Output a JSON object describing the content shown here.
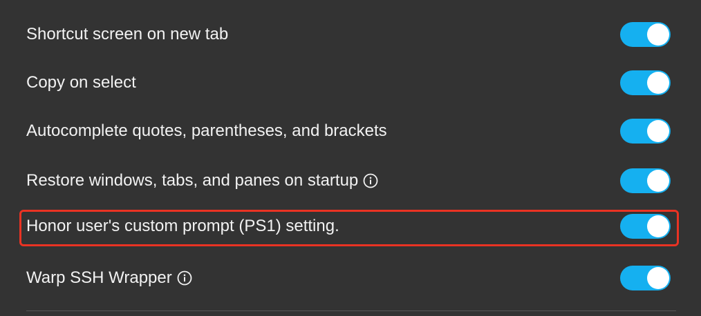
{
  "settings": [
    {
      "label": "Shortcut screen on new tab",
      "enabled": true,
      "has_info": false
    },
    {
      "label": "Copy on select",
      "enabled": true,
      "has_info": false
    },
    {
      "label": "Autocomplete quotes, parentheses, and brackets",
      "enabled": true,
      "has_info": false
    },
    {
      "label": "Restore windows, tabs, and panes on startup",
      "enabled": true,
      "has_info": true
    },
    {
      "label": "Honor user's custom prompt (PS1) setting.",
      "enabled": true,
      "has_info": false,
      "highlighted": true
    },
    {
      "label": "Warp SSH Wrapper",
      "enabled": true,
      "has_info": true
    }
  ],
  "colors": {
    "background": "#333333",
    "toggle_on": "#15b0f0",
    "highlight": "#ea3323",
    "text": "#f2f2f2"
  },
  "icons": {
    "info": "info-circle-icon"
  }
}
